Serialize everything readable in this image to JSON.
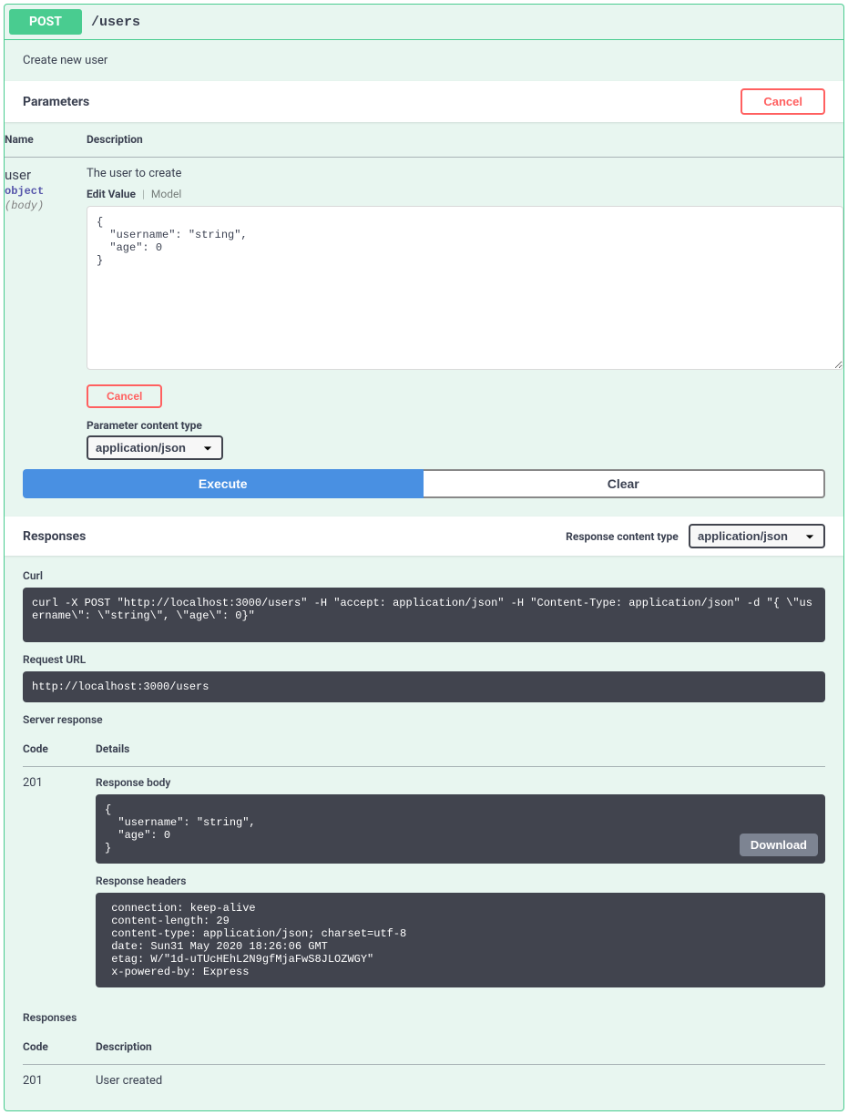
{
  "summary": {
    "method": "POST",
    "path": "/users",
    "description": "Create new user"
  },
  "parameters": {
    "heading": "Parameters",
    "cancel": "Cancel",
    "cols": {
      "name": "Name",
      "description": "Description"
    },
    "rows": [
      {
        "name": "user",
        "type": "object",
        "in": "(body)",
        "description": "The user to create",
        "tabs": {
          "editValue": "Edit Value",
          "model": "Model"
        },
        "bodyValue": "{\n  \"username\": \"string\",\n  \"age\": 0\n}",
        "cancel": "Cancel",
        "contentTypeLabel": "Parameter content type",
        "contentType": "application/json"
      }
    ]
  },
  "actions": {
    "execute": "Execute",
    "clear": "Clear"
  },
  "responses": {
    "heading": "Responses",
    "contentTypeLabel": "Response content type",
    "contentType": "application/json",
    "curlLabel": "Curl",
    "curl": "curl -X POST \"http://localhost:3000/users\" -H \"accept: application/json\" -H \"Content-Type: application/json\" -d \"{ \\\"username\\\": \\\"string\\\", \\\"age\\\": 0}\"",
    "requestUrlLabel": "Request URL",
    "requestUrl": "http://localhost:3000/users",
    "serverResponseLabel": "Server response",
    "cols": {
      "code": "Code",
      "details": "Details",
      "description": "Description"
    },
    "live": {
      "code": "201",
      "bodyLabel": "Response body",
      "body": "{\n  \"username\": \"string\",\n  \"age\": 0\n}",
      "download": "Download",
      "headersLabel": "Response headers",
      "headers": " connection: keep-alive \n content-length: 29 \n content-type: application/json; charset=utf-8 \n date: Sun31 May 2020 18:26:06 GMT \n etag: W/\"1d-uTUcHEhL2N9gfMjaFwS8JLOZWGY\" \n x-powered-by: Express "
    },
    "docLabel": "Responses",
    "documented": [
      {
        "code": "201",
        "description": "User created"
      }
    ]
  }
}
